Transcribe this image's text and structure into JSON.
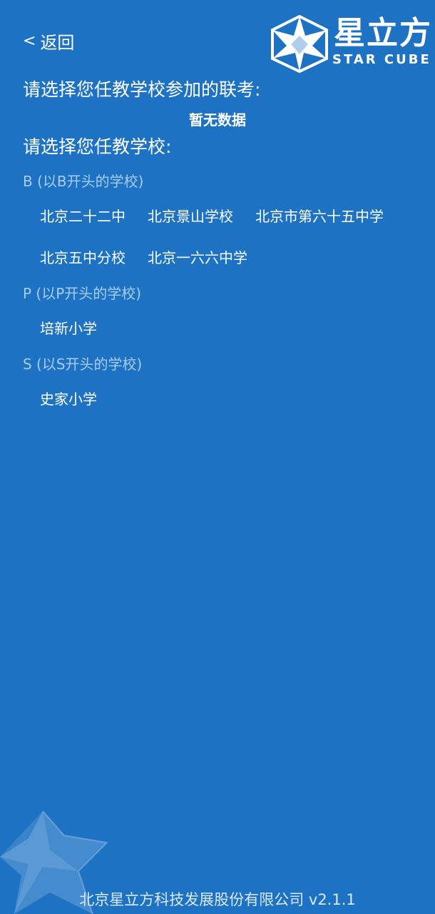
{
  "header": {
    "back_chevron": "<",
    "back_label": "返回",
    "logo_cn": "星立方",
    "logo_en": "STAR CUBE"
  },
  "exam": {
    "title": "请选择您任教学校参加的联考:",
    "empty": "暂无数据"
  },
  "schools": {
    "title": "请选择您任教学校:",
    "groups": [
      {
        "label": "B (以B开头的学校)",
        "items": [
          "北京二十二中",
          "北京景山学校",
          "北京市第六十五中学",
          "北京五中分校",
          "北京一六六中学"
        ]
      },
      {
        "label": "P (以P开头的学校)",
        "items": [
          "培新小学"
        ]
      },
      {
        "label": "S (以S开头的学校)",
        "items": [
          "史家小学"
        ]
      }
    ]
  },
  "footer": {
    "text": "北京星立方科技发展股份有限公司 v2.1.1"
  },
  "colors": {
    "background": "#1d72c4",
    "group_label": "#a9cdf0",
    "text": "#ffffff"
  }
}
